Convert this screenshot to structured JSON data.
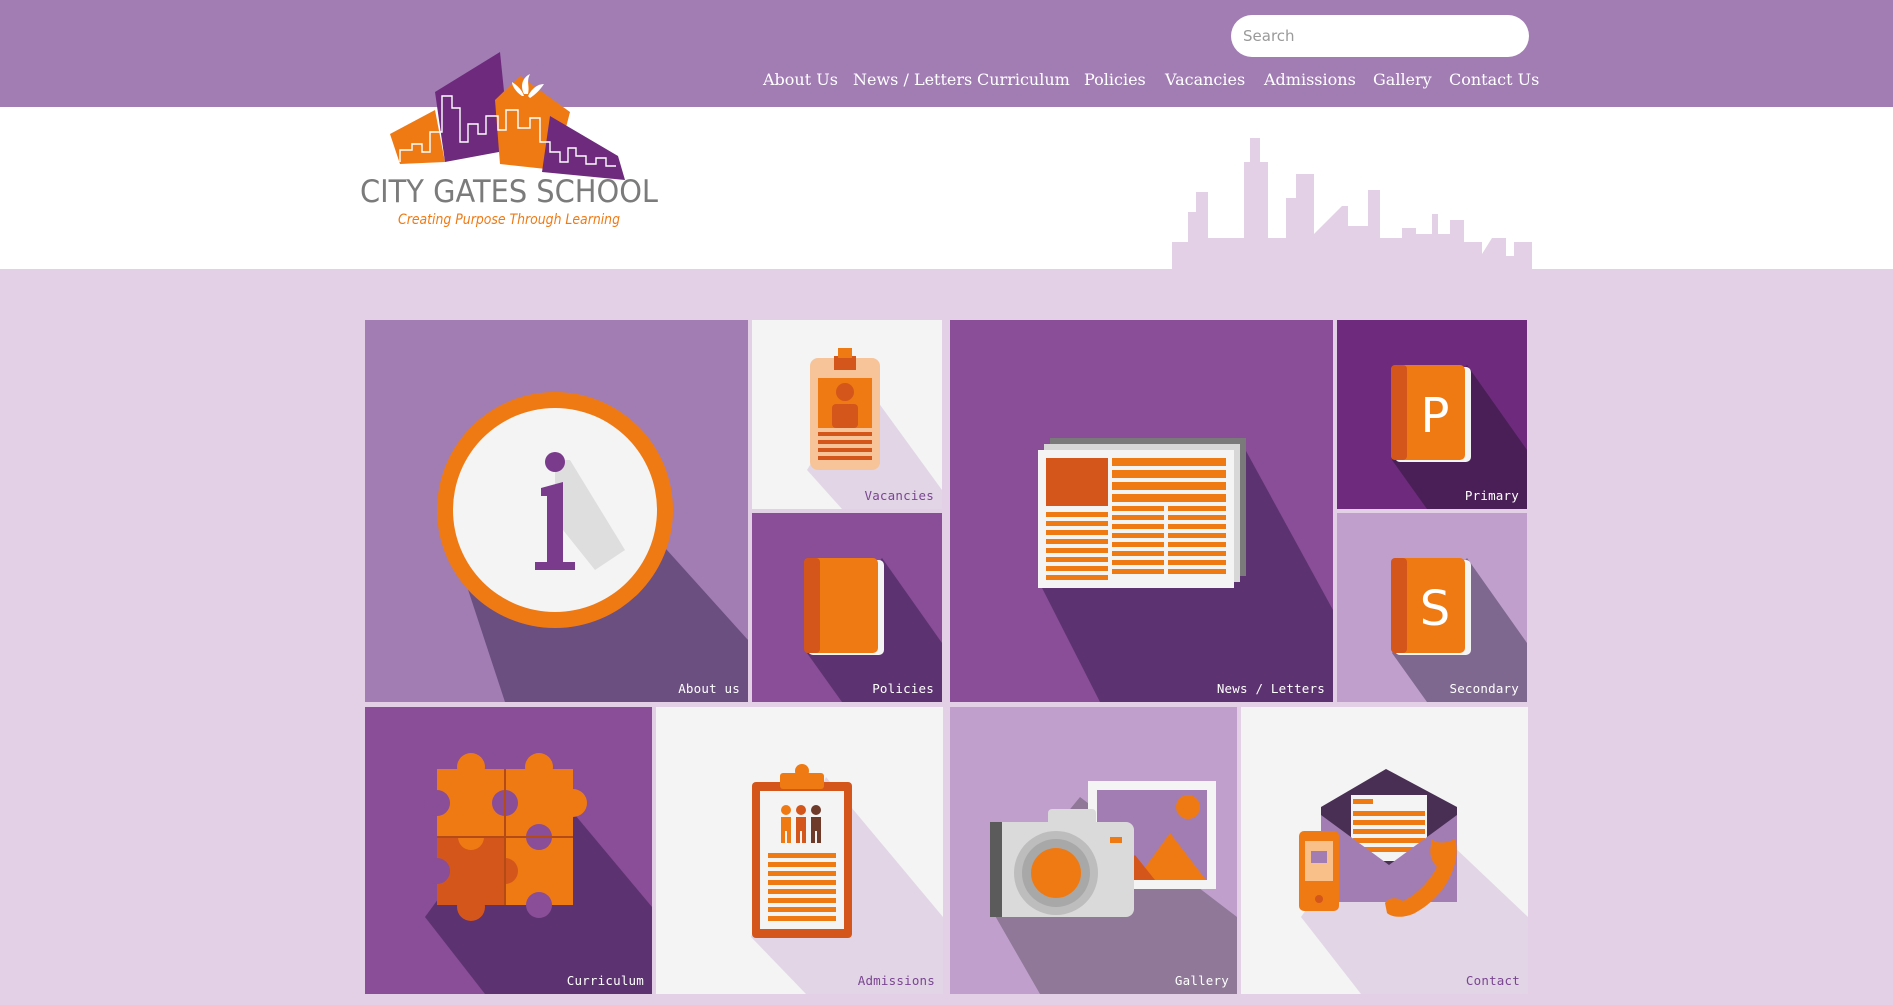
{
  "search": {
    "placeholder": "Search"
  },
  "nav": [
    {
      "label": "About Us"
    },
    {
      "label": "News / Letters"
    },
    {
      "label": "Curriculum"
    },
    {
      "label": "Policies"
    },
    {
      "label": "Vacancies"
    },
    {
      "label": "Admissions"
    },
    {
      "label": "Gallery"
    },
    {
      "label": "Contact Us"
    }
  ],
  "logo": {
    "name": "CITY GATES SCHOOL",
    "tagline": "Creating Purpose Through Learning"
  },
  "tiles": {
    "about": {
      "label": "About us",
      "icon": "info-icon"
    },
    "vacancies": {
      "label": "Vacancies",
      "icon": "id-badge-icon"
    },
    "policies": {
      "label": "Policies",
      "icon": "book-icon"
    },
    "news": {
      "label": "News / Letters",
      "icon": "newspaper-icon"
    },
    "primary": {
      "label": "Primary",
      "icon": "book-p-icon",
      "letter": "P"
    },
    "secondary": {
      "label": "Secondary",
      "icon": "book-s-icon",
      "letter": "S"
    },
    "curriculum": {
      "label": "Curriculum",
      "icon": "puzzle-icon"
    },
    "admissions": {
      "label": "Admissions",
      "icon": "clipboard-icon"
    },
    "gallery": {
      "label": "Gallery",
      "icon": "camera-icon"
    },
    "contact": {
      "label": "Contact",
      "icon": "envelope-phone-icon"
    }
  },
  "colors": {
    "header_purple": "#a27db4",
    "page_lavender": "#e3cfe6",
    "orange": "#ef7a14",
    "dark_orange": "#d4561b",
    "purple": "#8a4d97",
    "deep_purple": "#6e2a7c",
    "light_purple": "#c09fcc",
    "light_gray": "#f4f4f4"
  }
}
